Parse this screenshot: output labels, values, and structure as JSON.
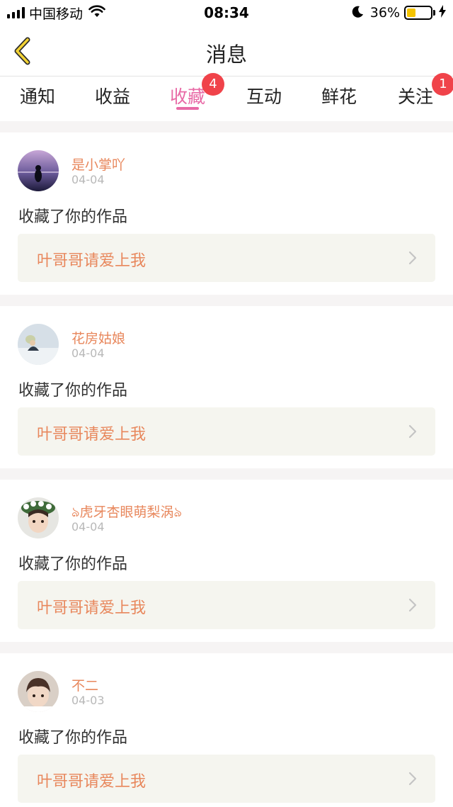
{
  "status_bar": {
    "carrier": "中国移动",
    "time": "08:34",
    "battery_percent": "36%",
    "battery_level": 0.36,
    "icons": [
      "signal-icon",
      "wifi-icon",
      "moon-icon",
      "battery-icon",
      "charging-icon"
    ]
  },
  "nav": {
    "title": "消息",
    "back_icon": "chevron-left-icon"
  },
  "tabs": [
    {
      "label": "通知",
      "badge": "",
      "active": false
    },
    {
      "label": "收益",
      "badge": "",
      "active": false
    },
    {
      "label": "收藏",
      "badge": "4",
      "active": true
    },
    {
      "label": "互动",
      "badge": "",
      "active": false
    },
    {
      "label": "鲜花",
      "badge": "",
      "active": false
    },
    {
      "label": "关注",
      "badge": "1",
      "active": false
    }
  ],
  "colors": {
    "accent_pink": "#e86aa6",
    "name_orange": "#e8875c",
    "badge_red": "#f0434a",
    "back_yellow": "#f2d234"
  },
  "messages": [
    {
      "user": "是小掌吖",
      "date": "04-04",
      "action": "收藏了你的作品",
      "work_title": "叶哥哥请爱上我"
    },
    {
      "user": "花房姑娘",
      "date": "04-04",
      "action": "收藏了你的作品",
      "work_title": "叶哥哥请爱上我"
    },
    {
      "user": "ঌ虎牙杏眼萌梨涡ঌ",
      "date": "04-04",
      "action": "收藏了你的作品",
      "work_title": "叶哥哥请爱上我"
    },
    {
      "user": "不二",
      "date": "04-03",
      "action": "收藏了你的作品",
      "work_title": "叶哥哥请爱上我"
    }
  ]
}
